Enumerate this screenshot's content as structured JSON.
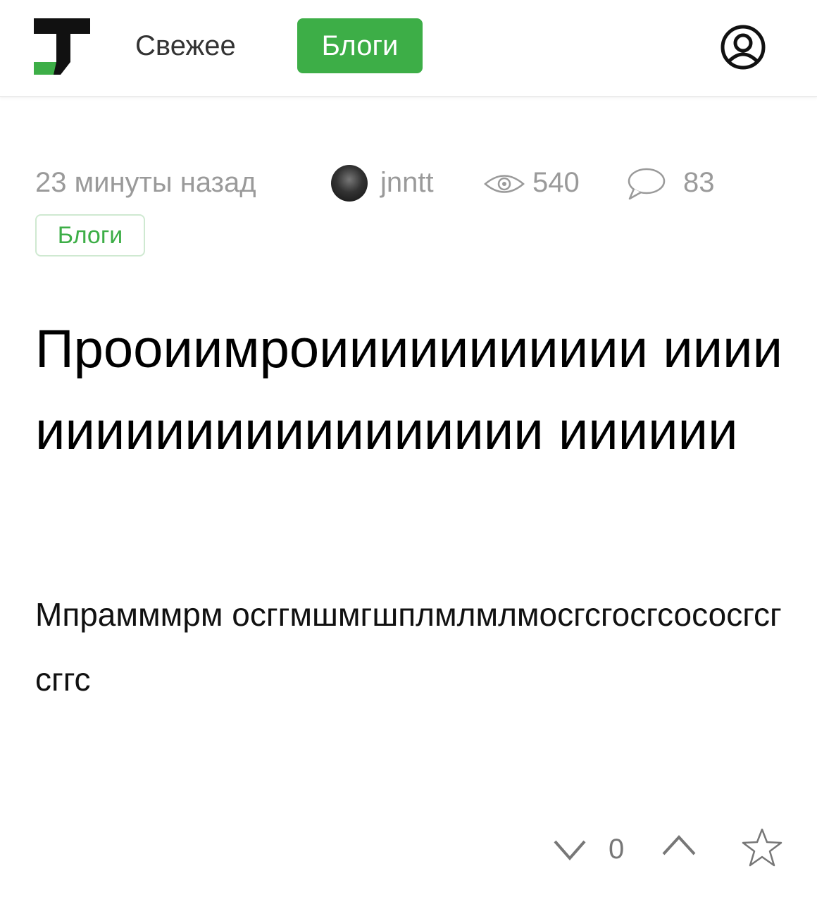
{
  "header": {
    "logo_icon": "tj-logo-icon",
    "nav": {
      "fresh_label": "Свежее",
      "blogs_label": "Блоги"
    },
    "profile_icon": "user-circle-icon",
    "accent_color": "#3dae47"
  },
  "post": {
    "time": "23 минуты назад",
    "author": "jnntt",
    "views": "540",
    "comments": "83",
    "tag": "Блоги",
    "title": "Прооиимроиииииииииии иииииииииииииииииииии ииииии",
    "body": "Мпрамммрм осггмшмгшплмлмлмосгсгосгсососгсг сггс"
  },
  "footer": {
    "vote_count": "0",
    "icons": [
      "chevron-down-icon",
      "chevron-up-icon",
      "star-icon"
    ]
  }
}
